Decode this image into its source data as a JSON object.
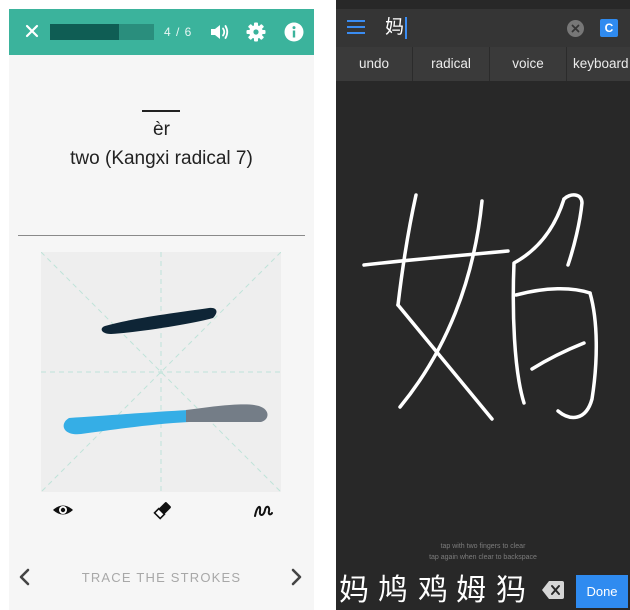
{
  "left_app": {
    "progress": {
      "current": 4,
      "total": 6,
      "label": "4 / 6"
    },
    "character": {
      "pinyin": "èr",
      "meaning": "two (Kangxi radical 7)"
    },
    "nav": {
      "label": "TRACE THE STROKES"
    },
    "colors": {
      "topbar": "#3bb39c",
      "progress_track": "#2a8e7d",
      "progress_fill": "#0f5d54",
      "stroke_done": "#0e2536",
      "stroke_active": "#35aee6",
      "stroke_remaining": "#747d87",
      "guide_lines": "#bfe3d9"
    },
    "icons": {
      "close": "close-icon",
      "sound": "speaker-icon",
      "settings": "gear-icon",
      "info": "info-icon",
      "eye": "eye-icon",
      "eraser": "eraser-icon",
      "draw": "squiggle-draw-icon",
      "prev": "chevron-left-icon",
      "next": "chevron-right-icon"
    }
  },
  "right_app": {
    "input": {
      "value": "妈"
    },
    "c_button_label": "C",
    "toolbar": {
      "undo": "undo",
      "radical": "radical",
      "voice": "voice",
      "keyboard": "keyboard"
    },
    "hints": {
      "line1": "tap with two fingers to clear",
      "line2": "tap again when clear to backspace"
    },
    "candidates": [
      "妈",
      "鸠",
      "鸡",
      "姆",
      "犸"
    ],
    "done_label": "Done",
    "colors": {
      "background": "#282828",
      "topbar": "#353535",
      "toolbar": "#3a3a3a",
      "accent": "#2f8bf0",
      "ink": "#ffffff"
    },
    "icons": {
      "menu": "menu-icon",
      "clear": "clear-circle-icon",
      "backspace": "backspace-icon"
    }
  }
}
